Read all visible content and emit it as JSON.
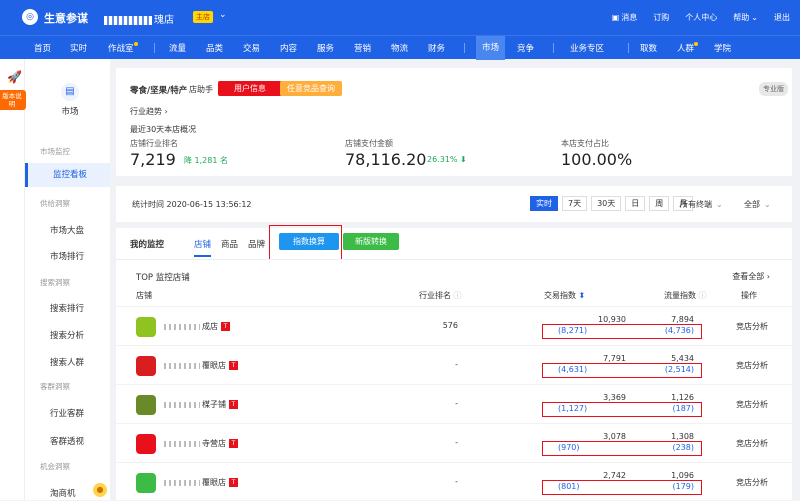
{
  "topbar": {
    "brand": "生意参谋",
    "shop_suffix": "瑰店",
    "main_badge": "主店",
    "links": [
      "消息",
      "订购",
      "个人中心",
      "帮助",
      "退出"
    ]
  },
  "nav": {
    "items": [
      "首页",
      "实时",
      "作战室",
      "流量",
      "品类",
      "交易",
      "内容",
      "服务",
      "营销",
      "物流",
      "财务",
      "市场",
      "竞争",
      "业务专区",
      "取数",
      "人群",
      "学院"
    ],
    "active": "市场"
  },
  "sidebar": {
    "version_tag": "版本说明",
    "group_label": "市场",
    "sections": [
      {
        "title": "市场监控",
        "items": [
          "监控看板"
        ]
      },
      {
        "title": "供给洞察",
        "items": [
          "市场大盘",
          "市场排行"
        ]
      },
      {
        "title": "搜索洞察",
        "items": [
          "搜索排行",
          "搜索分析",
          "搜索人群"
        ]
      },
      {
        "title": "客群洞察",
        "items": [
          "行业客群",
          "客群透视"
        ]
      },
      {
        "title": "机会洞察",
        "items": [
          "淘商机"
        ]
      }
    ],
    "active_item": "监控看板"
  },
  "overview": {
    "category": "零食/坚果/特产",
    "assistant": "店助手",
    "btn_user_info": "用户信息",
    "btn_query": "任意竞品查询",
    "pro_tag": "专业版",
    "trend_link": "行业趋势 ›",
    "period_title": "最近30天本店概况",
    "metrics": [
      {
        "label": "店铺行业排名",
        "value": "7,219",
        "change": "降 1,281 名"
      },
      {
        "label": "店铺支付金额",
        "value": "78,116.20",
        "change": "26.31% ⬇"
      },
      {
        "label": "本店支付占比",
        "value": "100.00%",
        "change": ""
      }
    ]
  },
  "filter": {
    "stat_time": "统计时间 2020-06-15 13:56:12",
    "range_tabs": [
      "实时",
      "7天",
      "30天",
      "日",
      "周",
      "月"
    ],
    "active_range": "实时",
    "terminal": "所有终端",
    "scope": "全部"
  },
  "monitor": {
    "title": "我的监控",
    "subtabs": [
      "店铺",
      "商品",
      "品牌"
    ],
    "active_subtab": "店铺",
    "btn_index": "指数换算",
    "btn_new": "新版转换",
    "list_title": "TOP 监控店铺",
    "view_all": "查看全部 ›",
    "columns": [
      "店铺",
      "行业排名",
      "交易指数",
      "流量指数",
      "操作"
    ],
    "rows": [
      {
        "name_suffix": "成店",
        "rank": "576",
        "trade": "10,930",
        "trade_conv": "(8,271)",
        "traffic": "7,894",
        "traffic_conv": "(4,736)",
        "op": "竞店分析",
        "color": "#8fc31f"
      },
      {
        "name_suffix": "覆眼店",
        "rank": "-",
        "trade": "7,791",
        "trade_conv": "(4,631)",
        "traffic": "5,434",
        "traffic_conv": "(2,514)",
        "op": "竞店分析",
        "color": "#d81e1e"
      },
      {
        "name_suffix": "楳子铺",
        "rank": "-",
        "trade": "3,369",
        "trade_conv": "(1,127)",
        "traffic": "1,126",
        "traffic_conv": "(187)",
        "op": "竞店分析",
        "color": "#6a8a2a"
      },
      {
        "name_suffix": "寺营店",
        "rank": "-",
        "trade": "3,078",
        "trade_conv": "(970)",
        "traffic": "1,308",
        "traffic_conv": "(238)",
        "op": "竞店分析",
        "color": "#e8101b"
      },
      {
        "name_suffix": "覆眼店",
        "rank": "-",
        "trade": "2,742",
        "trade_conv": "(801)",
        "traffic": "1,096",
        "traffic_conv": "(179)",
        "op": "竞店分析",
        "color": "#3dbb47"
      }
    ]
  },
  "colors": {
    "primary": "#2062e6",
    "red": "#e8101b",
    "orange": "#ffad3b",
    "green": "#3dbb47"
  }
}
